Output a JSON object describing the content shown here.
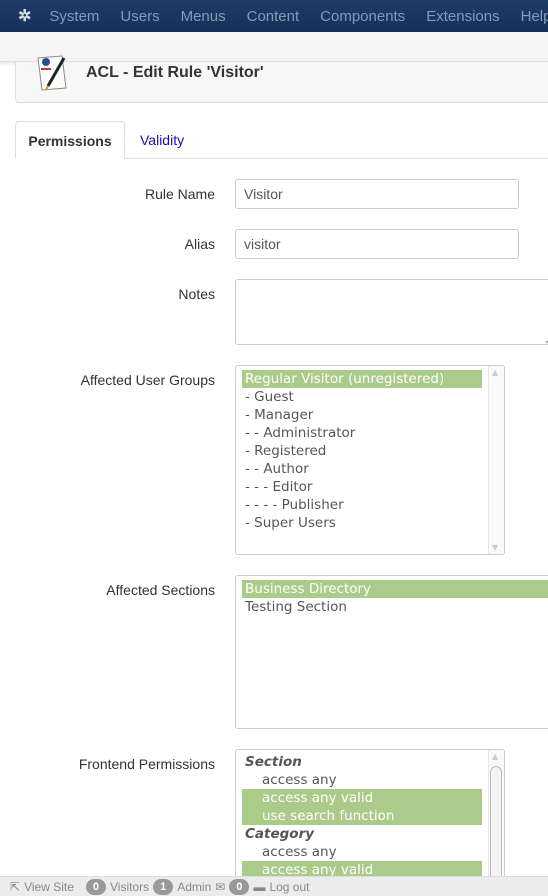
{
  "nav": {
    "items": [
      "System",
      "Users",
      "Menus",
      "Content",
      "Components",
      "Extensions",
      "Help"
    ]
  },
  "header": {
    "title": "ACL - Edit Rule 'Visitor'"
  },
  "tabs": [
    {
      "label": "Permissions",
      "active": true
    },
    {
      "label": "Validity",
      "active": false
    }
  ],
  "form": {
    "rule_name": {
      "label": "Rule Name",
      "value": "Visitor"
    },
    "alias": {
      "label": "Alias",
      "value": "visitor"
    },
    "notes": {
      "label": "Notes",
      "value": ""
    },
    "groups": {
      "label": "Affected User Groups",
      "options": [
        {
          "text": "Regular Visitor (unregistered)",
          "selected": true
        },
        {
          "text": "- Guest",
          "selected": false
        },
        {
          "text": "- Manager",
          "selected": false
        },
        {
          "text": "- - Administrator",
          "selected": false
        },
        {
          "text": "- Registered",
          "selected": false
        },
        {
          "text": "- - Author",
          "selected": false
        },
        {
          "text": "- - - Editor",
          "selected": false
        },
        {
          "text": "- - - - Publisher",
          "selected": false
        },
        {
          "text": "- Super Users",
          "selected": false
        }
      ]
    },
    "sections": {
      "label": "Affected Sections",
      "options": [
        {
          "text": "Business Directory",
          "selected": true
        },
        {
          "text": "Testing Section",
          "selected": false
        }
      ]
    },
    "frontend": {
      "label": "Frontend Permissions",
      "group1": "Section",
      "g1_opts": [
        {
          "text": "access any",
          "selected": false
        },
        {
          "text": "access any valid",
          "selected": true
        },
        {
          "text": "use search function",
          "selected": true
        }
      ],
      "group2": "Category",
      "g2_opts": [
        {
          "text": "access any",
          "selected": false
        },
        {
          "text": "access any valid",
          "selected": true
        }
      ]
    }
  },
  "footer": {
    "view_site": "View Site",
    "visitors_count": "0",
    "visitors": "Visitors",
    "admin_count": "1",
    "admin": "Admin",
    "messages_count": "0",
    "logout": "Log out"
  },
  "colors": {
    "navbar": "#1a3563",
    "selected_option": "#abcb8a",
    "link": "#1a0dab"
  }
}
